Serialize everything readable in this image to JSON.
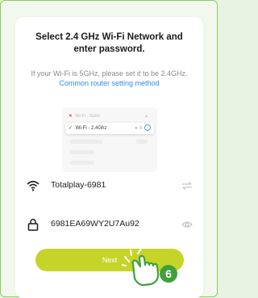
{
  "dialog": {
    "title": "Select 2.4 GHz Wi-Fi Network and enter password.",
    "subtitle": "If your Wi-Fi is 5GHz, please set it to be 2.4GHz.",
    "help_link": "Common router setting method"
  },
  "illustration": {
    "row_5g_label": "Wi-Fi - 5Ghz",
    "row_24g_label": "Wi-Fi - 2.4Ghz"
  },
  "wifi": {
    "ssid": "Totalplay-6981",
    "ssid_icon": "wifi-icon",
    "switch_icon": "switch-network-icon"
  },
  "password": {
    "value": "6981EA69WY2U7Au92",
    "lock_icon": "lock-icon",
    "visibility_icon": "eye-icon"
  },
  "next_button": {
    "label": "Next"
  },
  "step_marker": {
    "number": "6"
  },
  "colors": {
    "accent": "#c6d42a",
    "link": "#2f8de4",
    "border": "#8ccf5a",
    "step_badge": "#3fa13a"
  }
}
